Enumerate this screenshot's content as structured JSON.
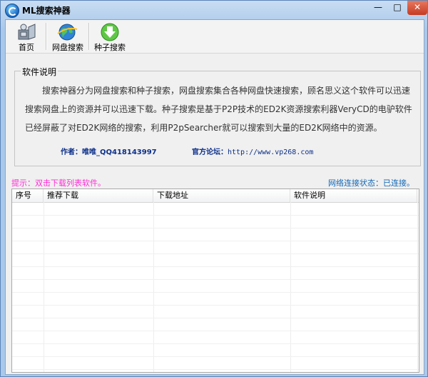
{
  "window": {
    "title": "ML搜索神器",
    "min_label": "—",
    "max_label": "□",
    "close_label": "✕"
  },
  "toolbar": {
    "items": [
      {
        "label": "首页",
        "icon": "home-icon"
      },
      {
        "label": "网盘搜索",
        "icon": "globe-icon"
      },
      {
        "label": "种子搜索",
        "icon": "download-icon"
      }
    ]
  },
  "info": {
    "legend": "软件说明",
    "description": "搜索神器分为网盘搜索和种子搜索，网盘搜索集合各种网盘快速搜索，顾名思义这个软件可以迅速搜索网盘上的资源并可以迅速下载。种子搜索是基于P2P技术的ED2K资源搜索利器VeryCD的电驴软件已经屏蔽了对ED2K网络的搜索，利用P2pSearcher就可以搜索到大量的ED2K网络中的资源。",
    "author_label": "作者：",
    "author_value": "唯唯_QQ418143997",
    "forum_label": "官方论坛：",
    "forum_value": "http://www.vp268.com"
  },
  "hint": "提示：双击下载列表软件。",
  "status": "网络连接状态：已连接。",
  "list": {
    "columns": [
      "序号",
      "推荐下载",
      "下载地址",
      "软件说明"
    ],
    "rows": []
  }
}
